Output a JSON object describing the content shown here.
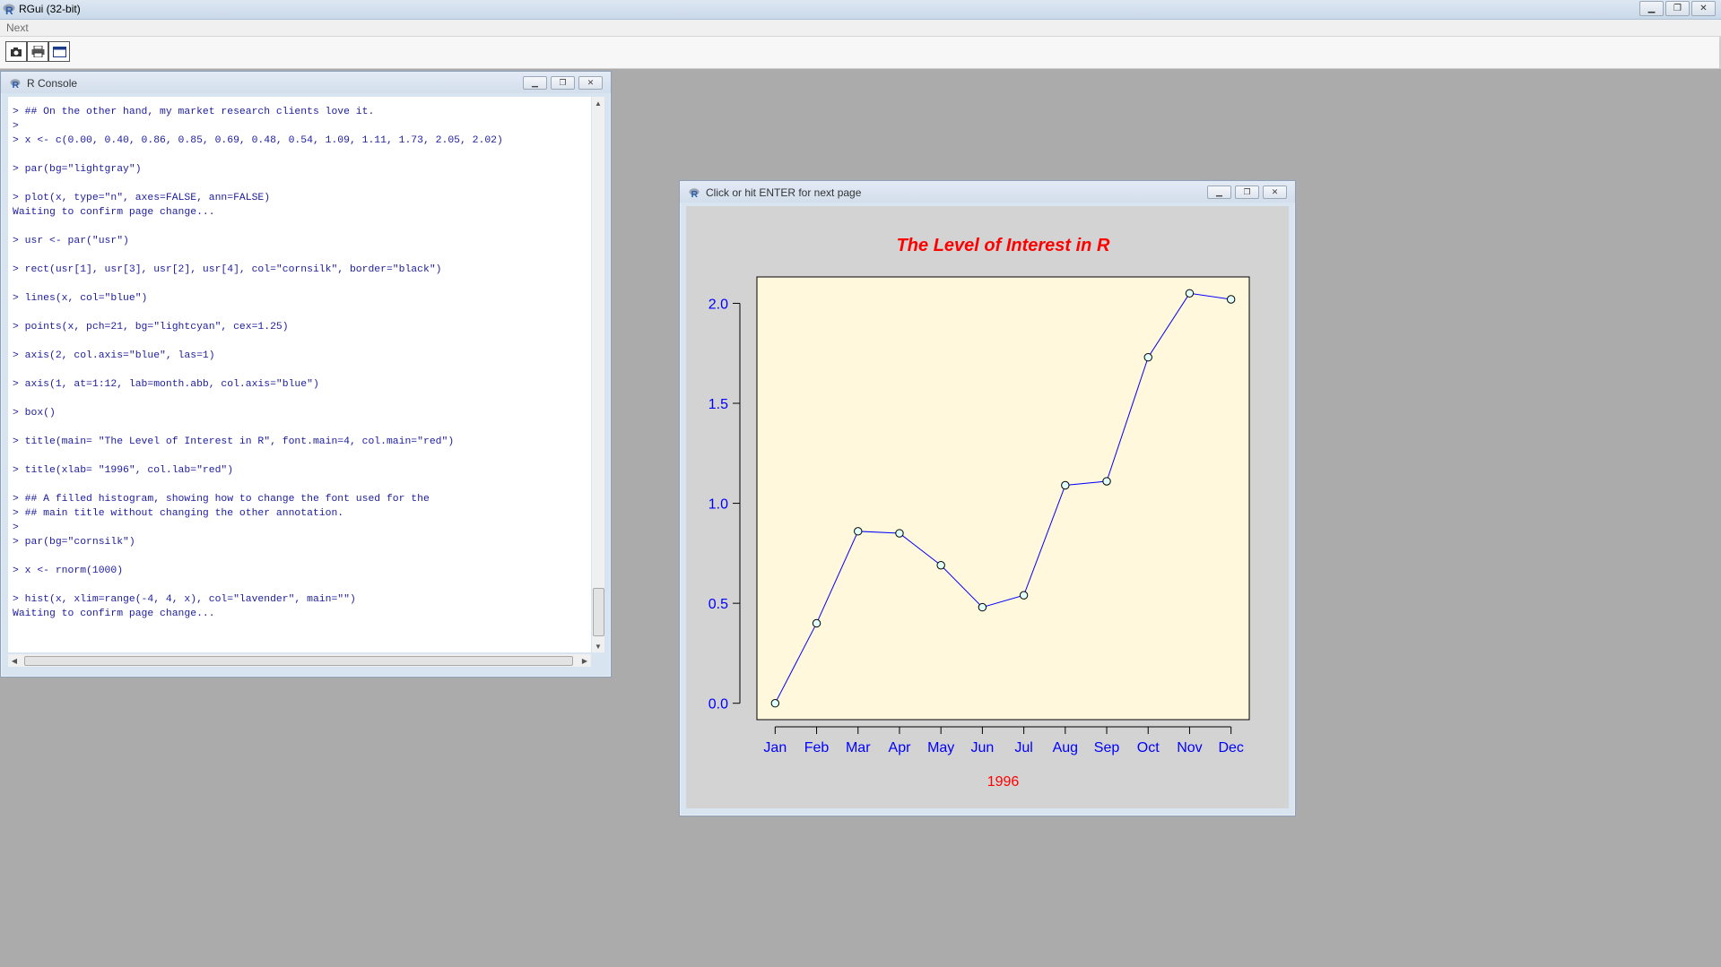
{
  "app": {
    "title": "RGui (32-bit)",
    "menu": [
      "Next"
    ],
    "toolbar_buttons": [
      "copy-to-clipboard-icon",
      "print-icon",
      "window-icon"
    ]
  },
  "console": {
    "title": "R Console",
    "lines": [
      "> ## On the other hand, my market research clients love it.",
      ">",
      "> x <- c(0.00, 0.40, 0.86, 0.85, 0.69, 0.48, 0.54, 1.09, 1.11, 1.73, 2.05, 2.02)",
      "",
      "> par(bg=\"lightgray\")",
      "",
      "> plot(x, type=\"n\", axes=FALSE, ann=FALSE)",
      "Waiting to confirm page change...",
      "",
      "> usr <- par(\"usr\")",
      "",
      "> rect(usr[1], usr[3], usr[2], usr[4], col=\"cornsilk\", border=\"black\")",
      "",
      "> lines(x, col=\"blue\")",
      "",
      "> points(x, pch=21, bg=\"lightcyan\", cex=1.25)",
      "",
      "> axis(2, col.axis=\"blue\", las=1)",
      "",
      "> axis(1, at=1:12, lab=month.abb, col.axis=\"blue\")",
      "",
      "> box()",
      "",
      "> title(main= \"The Level of Interest in R\", font.main=4, col.main=\"red\")",
      "",
      "> title(xlab= \"1996\", col.lab=\"red\")",
      "",
      "> ## A filled histogram, showing how to change the font used for the",
      "> ## main title without changing the other annotation.",
      ">",
      "> par(bg=\"cornsilk\")",
      "",
      "> x <- rnorm(1000)",
      "",
      "> hist(x, xlim=range(-4, 4, x), col=\"lavender\", main=\"\")",
      "Waiting to confirm page change..."
    ]
  },
  "graphics": {
    "title": "Click or hit ENTER for next page"
  },
  "chart_data": {
    "type": "line",
    "title": "The Level of Interest in R",
    "xlabel": "1996",
    "ylabel": "",
    "categories": [
      "Jan",
      "Feb",
      "Mar",
      "Apr",
      "May",
      "Jun",
      "Jul",
      "Aug",
      "Sep",
      "Oct",
      "Nov",
      "Dec"
    ],
    "values": [
      0.0,
      0.4,
      0.86,
      0.85,
      0.69,
      0.48,
      0.54,
      1.09,
      1.11,
      1.73,
      2.05,
      2.02
    ],
    "yticks": [
      "0.0",
      "0.5",
      "1.0",
      "1.5",
      "2.0"
    ],
    "ylim": [
      0.0,
      2.05
    ],
    "colors": {
      "line": "#0000ff",
      "axis_text": "#0000ff",
      "title": "#ff0000",
      "xlabel": "#ff0000",
      "plot_bg": "#fff8dc",
      "page_bg": "#d3d3d3",
      "point_fill": "#e0ffff"
    },
    "grid": false,
    "legend": "none"
  }
}
